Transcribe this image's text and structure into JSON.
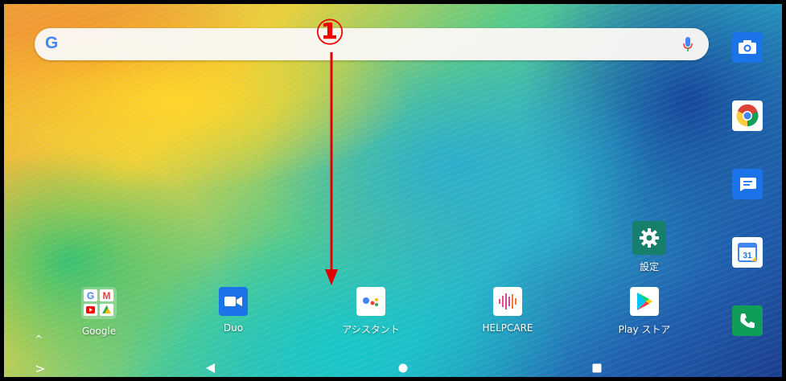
{
  "search": {
    "logo_text": "G"
  },
  "annotation": {
    "marker": "①",
    "color": "#e00000"
  },
  "dock": [
    {
      "label": "Google",
      "icon": "google-folder-icon"
    },
    {
      "label": "Duo",
      "icon": "duo-video-icon"
    },
    {
      "label": "アシスタント",
      "icon": "assistant-icon"
    },
    {
      "label": "HELPCARE",
      "icon": "helpcare-icon"
    },
    {
      "label": "Play ストア",
      "icon": "play-store-icon"
    }
  ],
  "settings": {
    "label": "設定",
    "icon": "gear-icon"
  },
  "right_rail": [
    {
      "icon": "camera-icon"
    },
    {
      "icon": "chrome-icon"
    },
    {
      "icon": "messages-icon"
    },
    {
      "icon": "calendar-icon",
      "date": "31"
    },
    {
      "icon": "phone-icon"
    }
  ],
  "navigation": {
    "expand_glyph": ">",
    "drawer_glyph": "^"
  }
}
